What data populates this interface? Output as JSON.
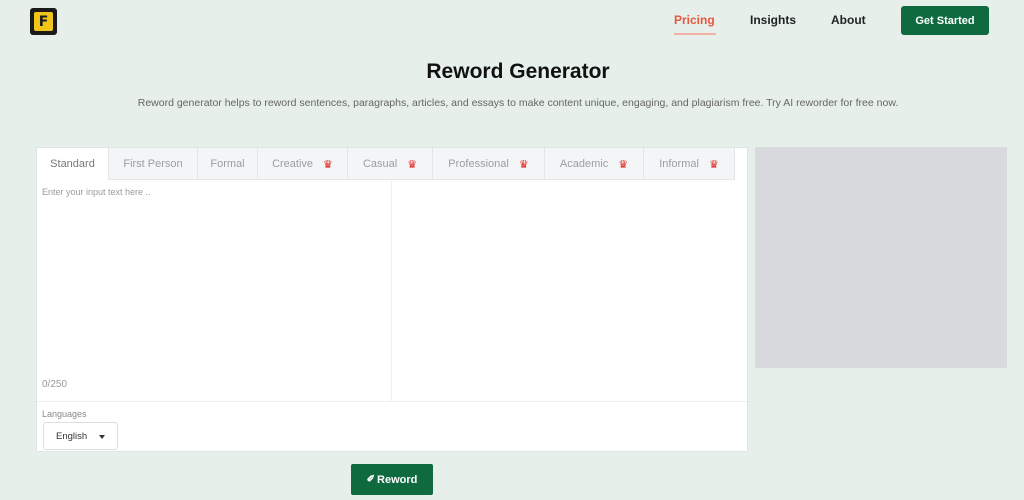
{
  "nav": {
    "logo_letter": "F",
    "links": [
      {
        "label": "Pricing",
        "active": true
      },
      {
        "label": "Insights"
      },
      {
        "label": "About"
      }
    ],
    "cta_label": "Get Started",
    "active_color": "#e8573e",
    "brand_color": "#0f6b3f"
  },
  "header": {
    "title": "Reword Generator",
    "subtitle": "Reword generator helps to reword sentences, paragraphs, articles, and essays to make content unique, engaging, and plagiarism free. Try AI reworder for free now."
  },
  "tabs": [
    {
      "label": "Standard",
      "active": true,
      "premium": false
    },
    {
      "label": "First Person",
      "premium": false
    },
    {
      "label": "Formal",
      "premium": false
    },
    {
      "label": "Creative",
      "premium": true
    },
    {
      "label": "Casual",
      "premium": true
    },
    {
      "label": "Professional",
      "premium": true
    },
    {
      "label": "Academic",
      "premium": true
    },
    {
      "label": "Informal",
      "premium": true
    }
  ],
  "editor": {
    "input_placeholder": "Enter your input text here ..",
    "input_value": "",
    "char_count": "0/250",
    "languages_label": "Languages",
    "language_selected": "English"
  },
  "actions": {
    "reword_label": "Reword",
    "reword_icon": "magic-wand-icon",
    "premium_icon": "crown-icon"
  }
}
